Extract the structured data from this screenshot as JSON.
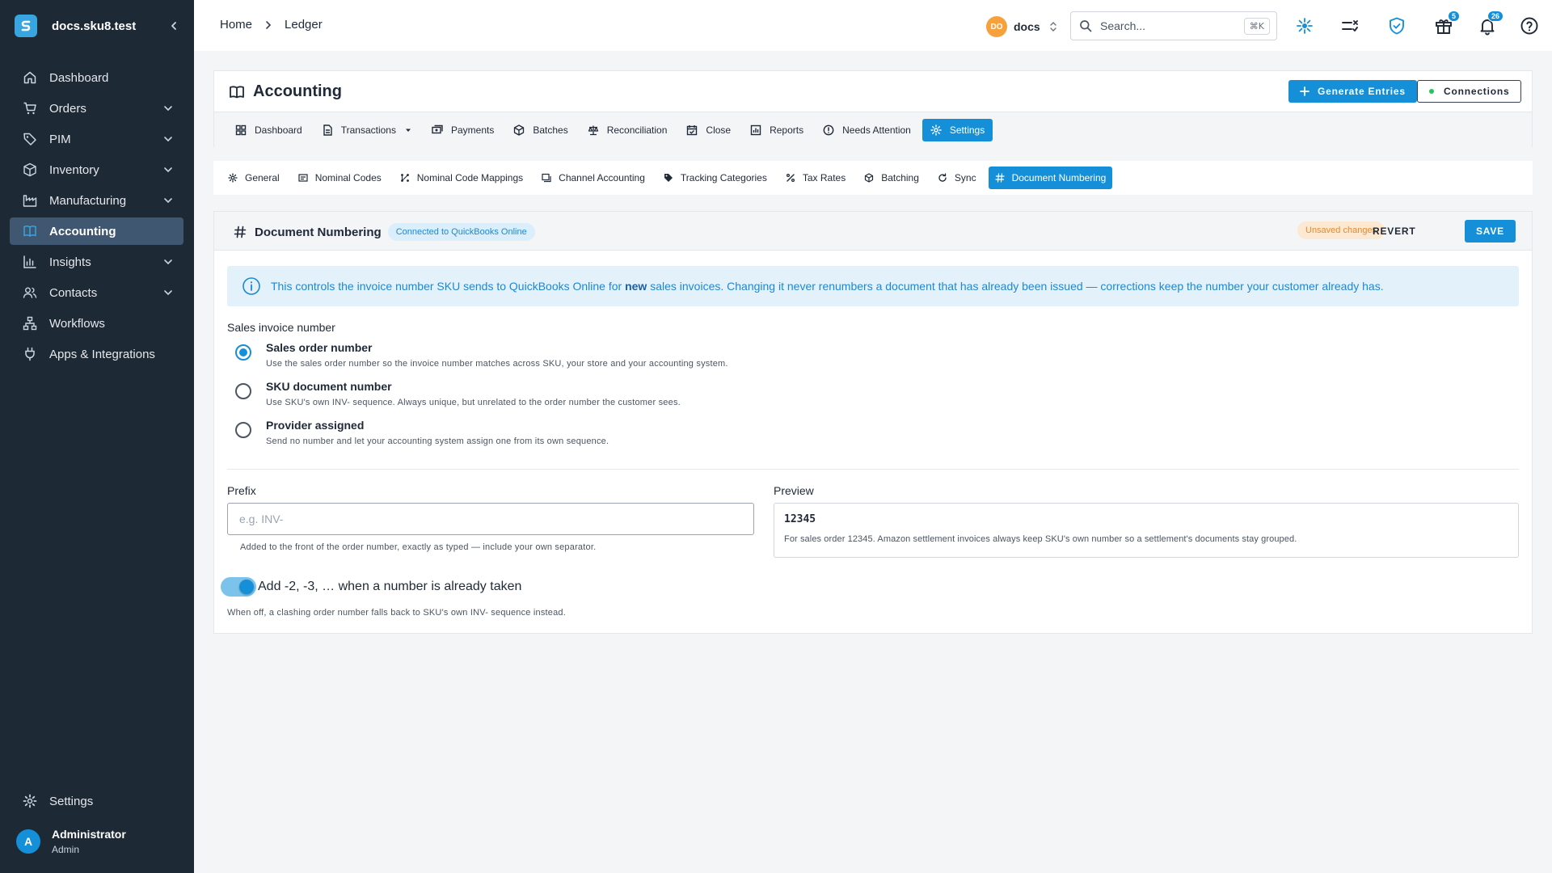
{
  "app": {
    "workspace": "docs.sku8.test"
  },
  "sidebar": {
    "items": [
      {
        "label": "Dashboard",
        "icon": "home-icon"
      },
      {
        "label": "Orders",
        "icon": "cart-icon"
      },
      {
        "label": "PIM",
        "icon": "tag-icon"
      },
      {
        "label": "Inventory",
        "icon": "box-icon"
      },
      {
        "label": "Manufacturing",
        "icon": "factory-icon"
      },
      {
        "label": "Accounting",
        "icon": "book-icon",
        "active": true
      },
      {
        "label": "Insights",
        "icon": "chart-icon"
      },
      {
        "label": "Contacts",
        "icon": "people-icon"
      },
      {
        "label": "Workflows",
        "icon": "workflow-icon"
      },
      {
        "label": "Apps & Integrations",
        "icon": "plug-icon"
      }
    ],
    "settings_label": "Settings",
    "user": {
      "initial": "A",
      "name": "Administrator",
      "role": "Admin"
    }
  },
  "topbar": {
    "breadcrumb": [
      "Home",
      "Ledger"
    ],
    "org": {
      "initials": "DO",
      "name": "docs"
    },
    "search": {
      "placeholder": "Search...",
      "shortcut": "⌘K"
    },
    "gift_badge": "5",
    "bell_badge": "26"
  },
  "accounting": {
    "title": "Accounting",
    "generate_label": "Generate Entries",
    "connections_label": "Connections",
    "tabs": [
      {
        "label": "Dashboard"
      },
      {
        "label": "Transactions"
      },
      {
        "label": "Payments"
      },
      {
        "label": "Batches"
      },
      {
        "label": "Reconciliation"
      },
      {
        "label": "Close"
      },
      {
        "label": "Reports"
      },
      {
        "label": "Needs Attention"
      },
      {
        "label": "Settings",
        "active": true
      }
    ],
    "subtabs": [
      {
        "label": "General"
      },
      {
        "label": "Nominal Codes"
      },
      {
        "label": "Nominal Code Mappings"
      },
      {
        "label": "Channel Accounting"
      },
      {
        "label": "Tracking Categories"
      },
      {
        "label": "Tax Rates"
      },
      {
        "label": "Batching"
      },
      {
        "label": "Sync"
      },
      {
        "label": "Document Numbering",
        "active": true
      }
    ]
  },
  "panel": {
    "title": "Document Numbering",
    "connected_chip": "Connected to QuickBooks Online",
    "unsaved_chip": "Unsaved changes",
    "revert_label": "REVERT",
    "save_label": "SAVE",
    "info": {
      "before": "This controls the invoice number SKU sends to QuickBooks Online for ",
      "bold": "new",
      "after": " sales invoices. Changing it never renumbers a document that has already been issued — corrections keep the number your customer already has."
    },
    "section_label": "Sales invoice number",
    "options": [
      {
        "title": "Sales order number",
        "desc": "Use the sales order number so the invoice number matches across SKU, your store and your accounting system.",
        "checked": true
      },
      {
        "title": "SKU document number",
        "desc": "Use SKU's own INV- sequence. Always unique, but unrelated to the order number the customer sees.",
        "checked": false
      },
      {
        "title": "Provider assigned",
        "desc": "Send no number and let your accounting system assign one from its own sequence.",
        "checked": false
      }
    ],
    "prefix": {
      "label": "Prefix",
      "value": "",
      "placeholder": "e.g. INV-",
      "helper": "Added to the front of the order number, exactly as typed — include your own separator."
    },
    "preview": {
      "label": "Preview",
      "number": "12345",
      "note": "For sales order 12345. Amazon settlement invoices always keep SKU's own number so a settlement's documents stay grouped."
    },
    "suffix_toggle": {
      "label": "Add -2, -3, … when a number is already taken",
      "on": true,
      "helper": "When off, a clashing order number falls back to SKU's own INV- sequence instead."
    }
  },
  "colors": {
    "sidebar_bg": "#1e2936",
    "accent": "#1590d8",
    "active_nav": "#3f5770",
    "info_bg": "#e3f1fb",
    "warning": "#e58a2e"
  }
}
